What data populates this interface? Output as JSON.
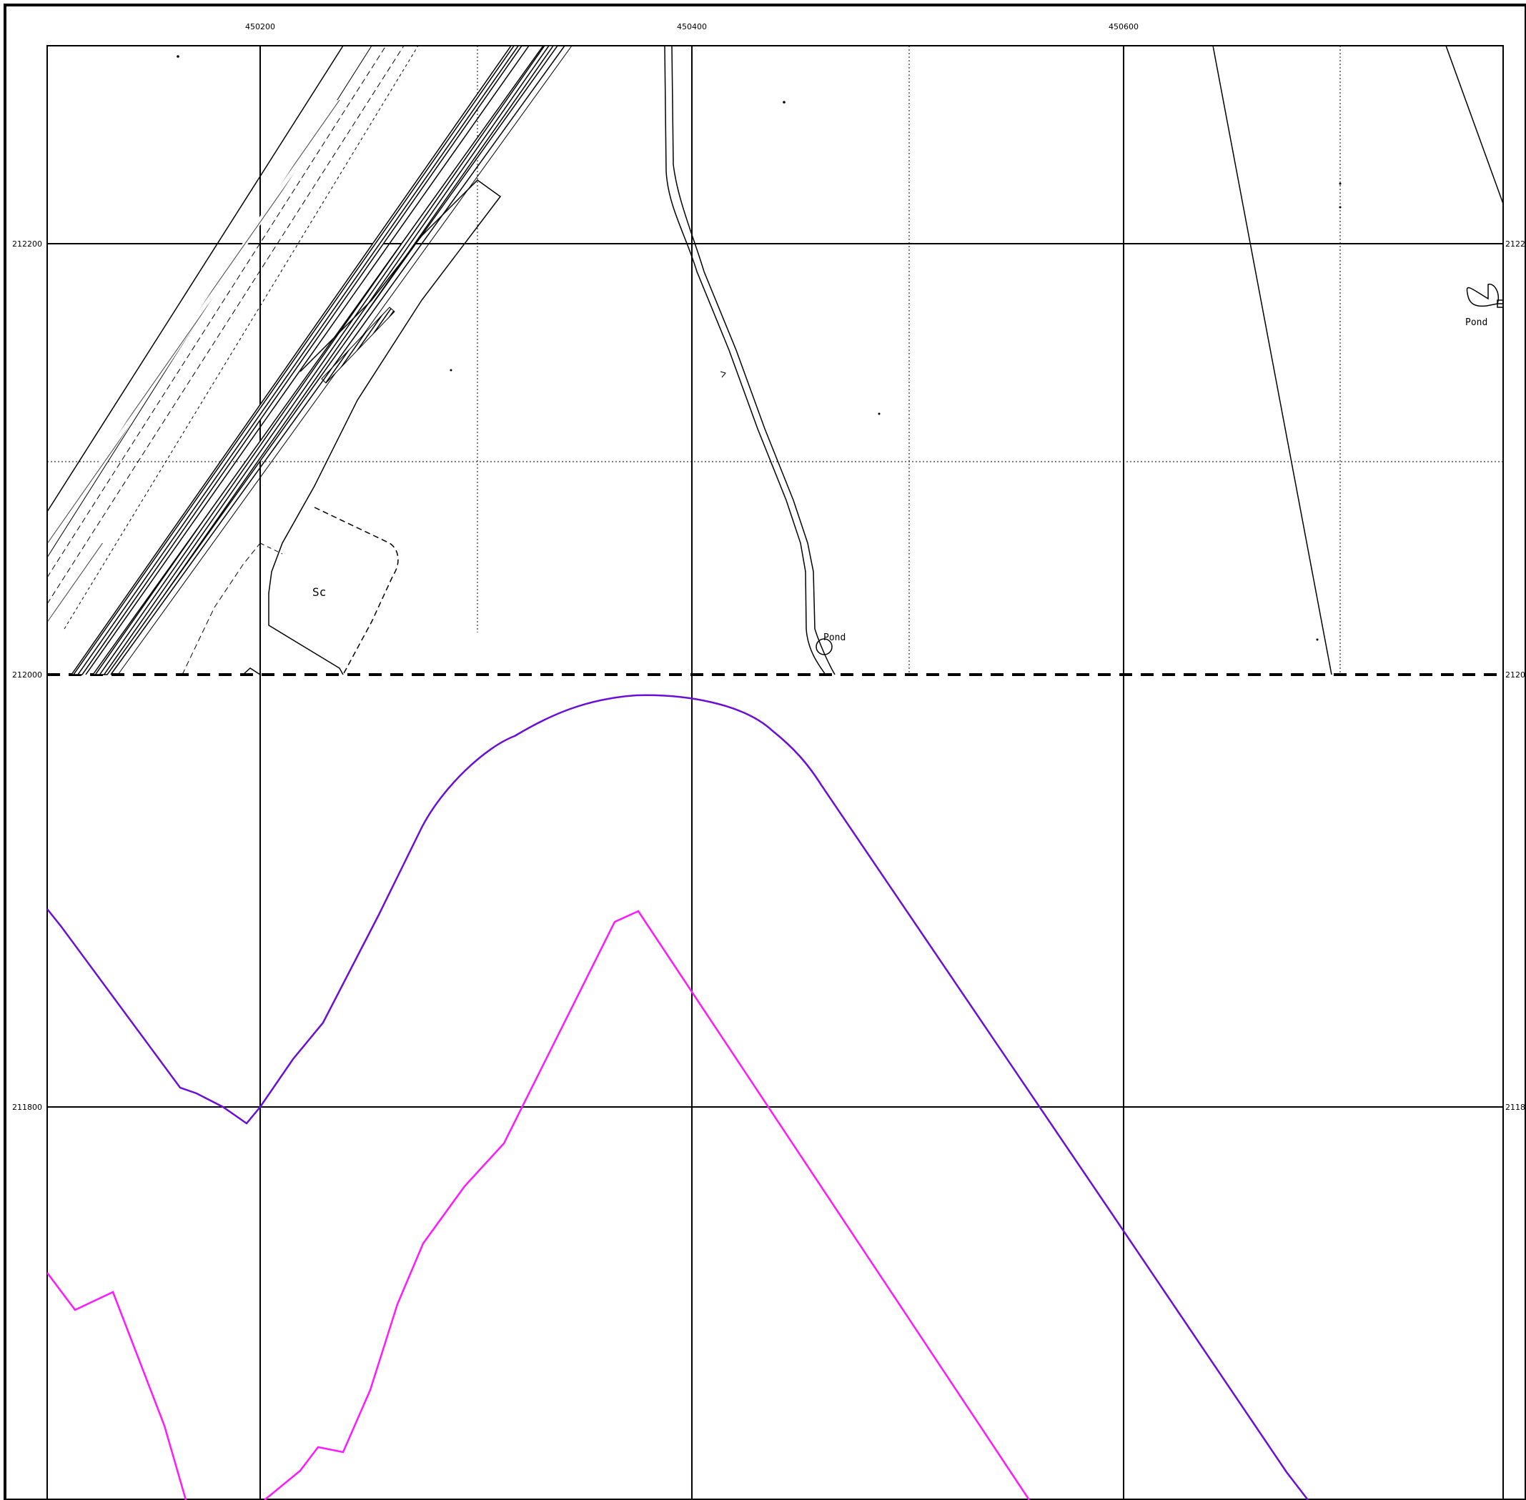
{
  "map": {
    "grid_labels": {
      "eastings": [
        "450200",
        "450400",
        "450600"
      ],
      "northings": [
        "212200",
        "212000",
        "211800"
      ],
      "northings_right": [
        "2122",
        "2120",
        "2118"
      ]
    },
    "features": {
      "sc_label": "Sc",
      "pond_label_center": "Pond",
      "pond_label_right": "Pond"
    },
    "colors": {
      "frame": "#000000",
      "boundary_dashed": "#000000",
      "purple_contour": "#6a0fd6",
      "magenta_contour": "#ff19ff",
      "hatch": "#000000"
    }
  }
}
